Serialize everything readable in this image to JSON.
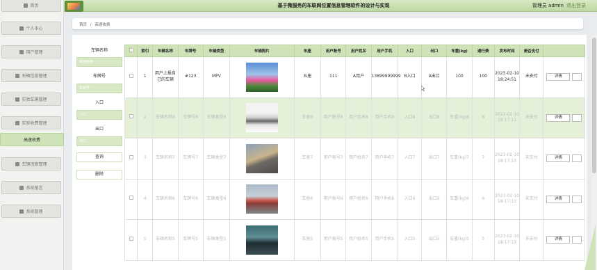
{
  "app": {
    "title": "基于微服务的车联网位置信息管理软件的设计与实现",
    "user": "管理员 admin",
    "logout": "退出登录"
  },
  "sidebar": {
    "items": [
      {
        "label": "首页",
        "icon": "home-icon"
      },
      {
        "label": "个人中心",
        "icon": "user-icon"
      },
      {
        "label": "用户管理",
        "icon": "users-icon"
      },
      {
        "label": "车辆信息管理",
        "icon": "car-icon"
      },
      {
        "label": "实验车辆管理",
        "icon": "grid-icon"
      },
      {
        "label": "实验收费管理",
        "icon": "grid-icon"
      },
      {
        "label": "高速收费",
        "icon": ""
      },
      {
        "label": "车辆违章管理",
        "icon": "flag-icon"
      },
      {
        "label": "系统留言",
        "icon": "send-icon"
      },
      {
        "label": "系统管理",
        "icon": "grid-icon"
      }
    ]
  },
  "breadcrumb": {
    "home": "首页",
    "separator": "/",
    "current": "高速收费"
  },
  "search": {
    "vehicle_name_label": "车辆名称",
    "vehicle_name_placeholder": "车辆名称",
    "plate_label": "车牌号",
    "plate_placeholder": "车牌号",
    "entry_label": "入口",
    "entry_placeholder": "入口",
    "exit_label": "出口",
    "exit_placeholder": "出口",
    "query_button": "查询",
    "delete_button": "删除"
  },
  "table": {
    "headers": [
      "索引",
      "车辆名称",
      "车牌号",
      "车辆类型",
      "车辆照片",
      "车座",
      "用户账号",
      "用户姓名",
      "用户手机",
      "入口",
      "出口",
      "车重(kg)",
      "通行费",
      "发布时间",
      "是否支付"
    ],
    "rows": [
      {
        "index": "1",
        "name": "用户上报自己的车辆",
        "plate": "#123",
        "type": "MPV",
        "seat": "五座",
        "account": "111",
        "username": "A用户",
        "phone": "13899999999",
        "entry": "B入口",
        "exit": "A出口",
        "weight": "100",
        "fee": "100",
        "time": "2023-02-10 18:24:51",
        "paid": "未支付"
      },
      {
        "index": "2",
        "name": "车辆名称8",
        "plate": "车牌号8",
        "type": "车辆类型8",
        "seat": "车座8",
        "account": "用户账号8",
        "username": "用户姓名8",
        "phone": "用户手机8",
        "entry": "入口8",
        "exit": "出口8",
        "weight": "车重(kg)8",
        "fee": "8",
        "time": "2023-02-10 18:17:13",
        "paid": "未支付"
      },
      {
        "index": "3",
        "name": "车辆名称7",
        "plate": "车牌号7",
        "type": "车辆类型7",
        "seat": "车座7",
        "account": "用户账号7",
        "username": "用户姓名7",
        "phone": "用户手机7",
        "entry": "入口7",
        "exit": "出口7",
        "weight": "车重(kg)7",
        "fee": "7",
        "time": "2023-02-10 18:17:13",
        "paid": "未支付"
      },
      {
        "index": "4",
        "name": "车辆名称6",
        "plate": "车牌号6",
        "type": "车辆类型6",
        "seat": "车座6",
        "account": "用户账号6",
        "username": "用户姓名6",
        "phone": "用户手机6",
        "entry": "入口6",
        "exit": "出口6",
        "weight": "车重(kg)6",
        "fee": "6",
        "time": "2023-02-10 18:17:13",
        "paid": "未支付"
      },
      {
        "index": "5",
        "name": "车辆名称5",
        "plate": "车牌号5",
        "type": "车辆类型5",
        "seat": "车座5",
        "account": "用户账号5",
        "username": "用户姓名5",
        "phone": "用户手机5",
        "entry": "入口5",
        "exit": "出口5",
        "weight": "车重(kg)5",
        "fee": "5",
        "time": "2023-02-10 18:17:13",
        "paid": "未支付"
      }
    ],
    "detail_button": "详情"
  },
  "colors": {
    "accent": "#cfe3b9",
    "accent_border": "#b9d29f",
    "input_fill": "#d8e8c5"
  }
}
